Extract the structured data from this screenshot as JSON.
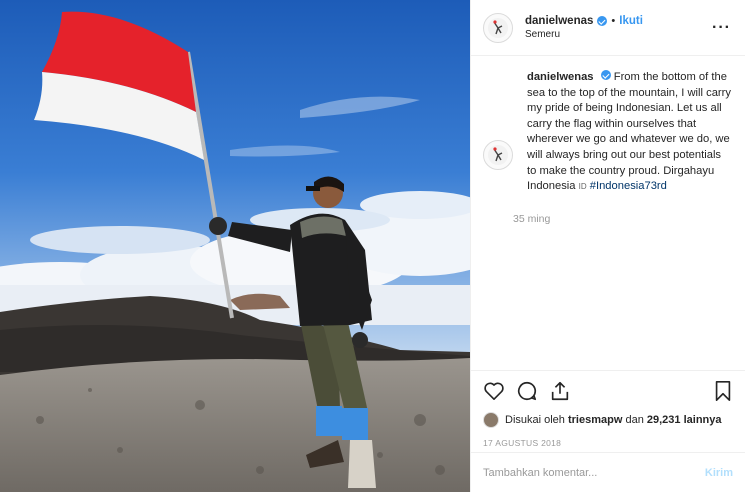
{
  "header": {
    "username": "danielwenas",
    "separator": "•",
    "follow_label": "Ikuti",
    "location": "Semeru",
    "more_icon": "more-dots-icon"
  },
  "caption": {
    "username": "danielwenas",
    "text": "From the bottom of the sea to the top of the mountain, I will carry my pride of being Indonesian. Let us all carry the flag within ourselves that wherever we go and whatever we do, we will always bring out our best potentials to make the country proud. Dirgahayu Indonesia",
    "flag_marker": "ID",
    "hashtag": "#Indonesia73rd",
    "time_ago": "35 ming"
  },
  "actions": {
    "icons": [
      "heart-icon",
      "comment-icon",
      "share-icon",
      "bookmark-icon"
    ]
  },
  "likes": {
    "prefix": "Disukai oleh",
    "liker": "triesmapw",
    "connector": "dan",
    "count_others": "29,231 lainnya"
  },
  "date": "17 AGUSTUS 2018",
  "comment_box": {
    "placeholder": "Tambahkan komentar...",
    "post_label": "Kirim"
  },
  "colors": {
    "accent": "#3897f0",
    "hashtag": "#003569",
    "flag_red": "#e5222b",
    "flag_white": "#f4f4f4",
    "sky": "#2f6fc4"
  }
}
